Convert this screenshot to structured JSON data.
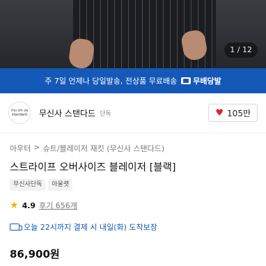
{
  "gallery": {
    "counter": "1 / 12"
  },
  "banner": {
    "text": "주 7일 언제나 당일발송, 전상품 무료배송",
    "badge_label": "무배당발",
    "icon": "truck-icon",
    "color": "#1458b8"
  },
  "brand": {
    "logo_line1": "mu sin sa",
    "logo_line2": "standard",
    "name": "무신사 스탠다드",
    "tag": "단독"
  },
  "like": {
    "icon": "heart-icon",
    "count": "105만"
  },
  "breadcrumb": [
    "아우터",
    ">",
    "슈트/블레이저 재킷 (무신사 스탠다드)"
  ],
  "product": {
    "title": "스트라이프 오버사이즈 블레이저 [블랙]",
    "tags": [
      "무신사단독",
      "아울렛"
    ],
    "rating": "4.9",
    "reviews": "후기 656개",
    "delivery": "오늘 22시까지 결제 시 내일(화) 도착보장",
    "price": "86,900원"
  }
}
